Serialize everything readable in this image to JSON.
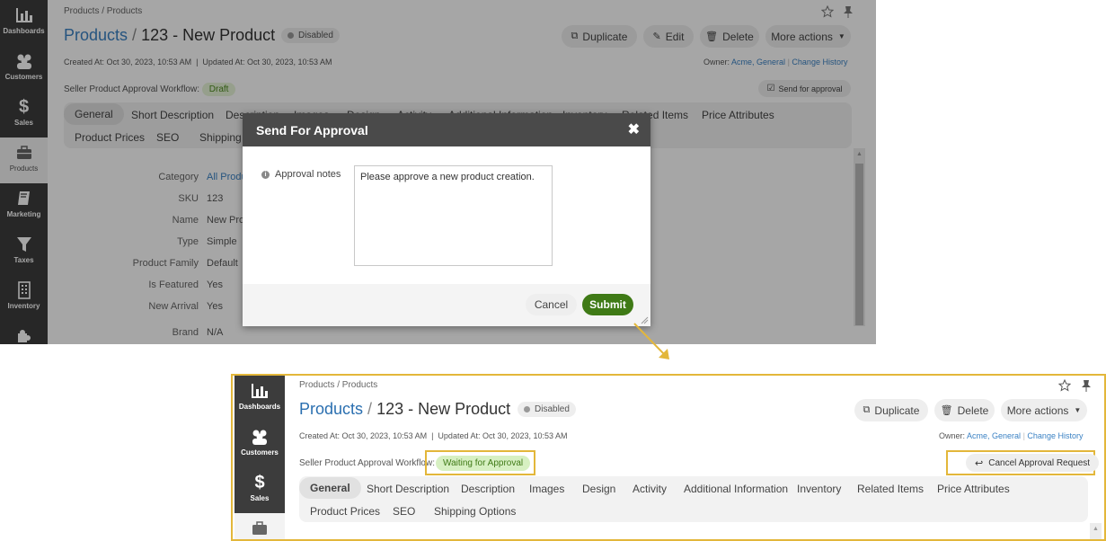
{
  "sidebar": {
    "items": [
      {
        "label": "Dashboards",
        "icon": "chart-icon"
      },
      {
        "label": "Customers",
        "icon": "users-icon"
      },
      {
        "label": "Sales",
        "icon": "dollar-icon"
      },
      {
        "label": "Products",
        "icon": "briefcase-icon"
      },
      {
        "label": "Marketing",
        "icon": "book-icon"
      },
      {
        "label": "Taxes",
        "icon": "filter-icon"
      },
      {
        "label": "Inventory",
        "icon": "building-icon"
      }
    ]
  },
  "top": {
    "breadcrumb": "Products / Products",
    "title_link": "Products",
    "title_sep": " / ",
    "title_name": "123 - New Product",
    "status": "Disabled",
    "buttons": {
      "duplicate": "Duplicate",
      "edit": "Edit",
      "delete": "Delete",
      "more": "More actions"
    },
    "meta": "Created At: Oct 30, 2023, 10:53 AM  |  Updated At: Oct 30, 2023, 10:53 AM",
    "owner_label": "Owner:",
    "owner_value": "Acme, General",
    "change_history": "Change History",
    "workflow_label": "Seller Product Approval Workflow:",
    "workflow_status": "Draft",
    "send_for_approval": "Send for approval",
    "tabs_row1": [
      "General",
      "Short Description",
      "Description",
      "Images",
      "Design",
      "Activity",
      "Additional Information",
      "Inventory",
      "Related Items",
      "Price Attributes"
    ],
    "tabs_row2": [
      "Product Prices",
      "SEO",
      "Shipping Options"
    ],
    "fields": [
      {
        "label": "Category",
        "value": "All Products"
      },
      {
        "label": "SKU",
        "value": "123"
      },
      {
        "label": "Name",
        "value": "New Product"
      },
      {
        "label": "Type",
        "value": "Simple"
      },
      {
        "label": "Product Family",
        "value": "Default"
      },
      {
        "label": "Is Featured",
        "value": "Yes"
      },
      {
        "label": "New Arrival",
        "value": "Yes"
      },
      {
        "label": "Brand",
        "value": "N/A"
      }
    ]
  },
  "modal": {
    "title": "Send For Approval",
    "notes_label": "Approval notes",
    "notes_value": "Please approve a new product creation.",
    "cancel": "Cancel",
    "submit": "Submit"
  },
  "bottom": {
    "breadcrumb": "Products / Products",
    "title_link": "Products",
    "title_sep": " / ",
    "title_name": "123 - New Product",
    "status": "Disabled",
    "buttons": {
      "duplicate": "Duplicate",
      "delete": "Delete",
      "more": "More actions"
    },
    "meta": "Created At: Oct 30, 2023, 10:53 AM  |  Updated At: Oct 30, 2023, 10:53 AM",
    "owner_label": "Owner:",
    "owner_value": "Acme, General",
    "change_history": "Change History",
    "workflow_label": "Seller Product Approval Workflow:",
    "workflow_status": "Waiting for Approval",
    "cancel_request": "Cancel Approval Request",
    "tabs_row1": [
      "General",
      "Short Description",
      "Description",
      "Images",
      "Design",
      "Activity",
      "Additional Information",
      "Inventory",
      "Related Items",
      "Price Attributes"
    ],
    "tabs_row2": [
      "Product Prices",
      "SEO",
      "Shipping Options"
    ]
  },
  "colors": {
    "accent": "#3b82c4",
    "highlight": "#e3b73a",
    "submit": "#3f7a16",
    "sidebar": "#3c3c3c"
  }
}
